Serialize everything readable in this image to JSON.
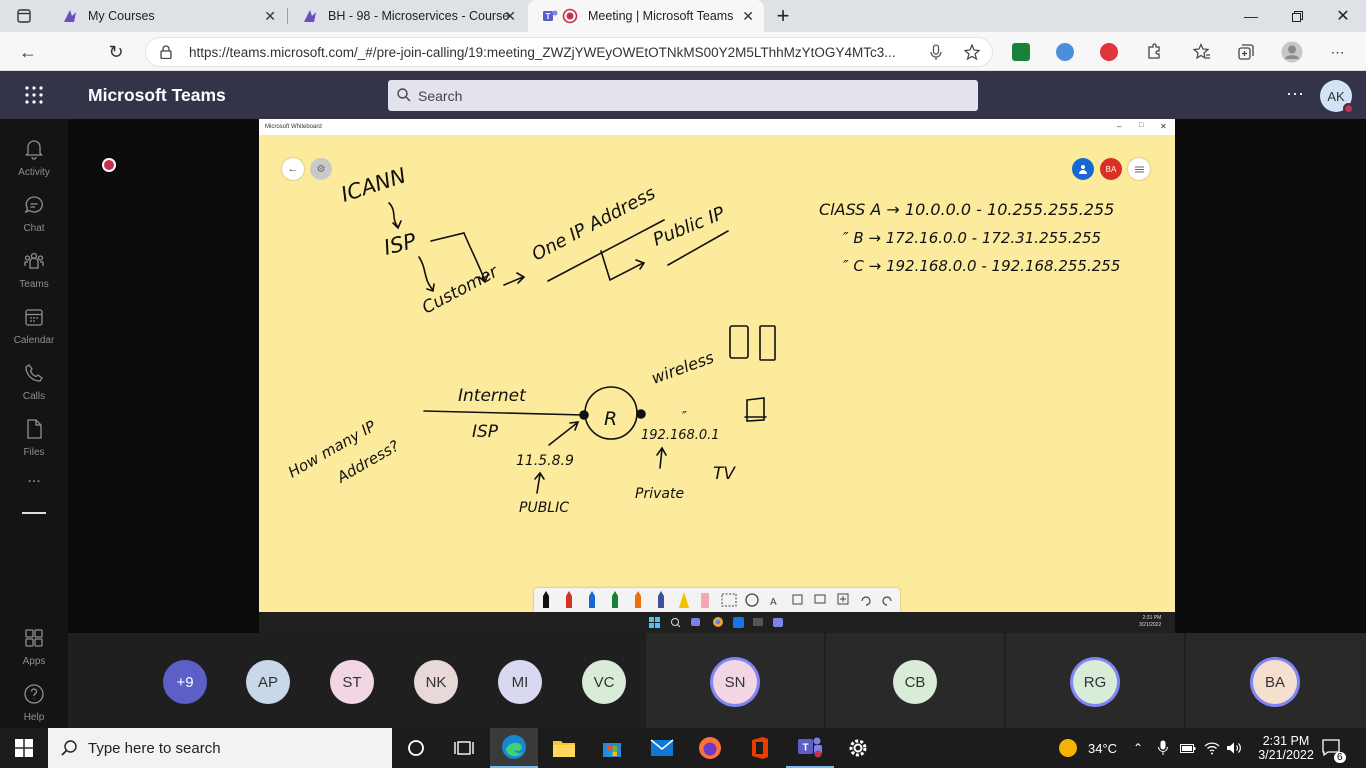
{
  "browser": {
    "tabs": [
      {
        "title": "My Courses"
      },
      {
        "title": "BH - 98 - Microservices - Course"
      },
      {
        "title": "Meeting | Microsoft Teams"
      }
    ],
    "new_tab": "+",
    "url": "https://teams.microsoft.com/_#/pre-join-calling/19:meeting_ZWZjYWEyOWEtOTNkMS00Y2M5LThhMzYtOGY4MTc3..."
  },
  "teams": {
    "app_name": "Microsoft Teams",
    "search_placeholder": "Search",
    "user_initials": "AK",
    "rail": [
      {
        "label": "Activity",
        "icon": "bell-icon"
      },
      {
        "label": "Chat",
        "icon": "chat-icon"
      },
      {
        "label": "Teams",
        "icon": "teams-icon"
      },
      {
        "label": "Calendar",
        "icon": "calendar-icon"
      },
      {
        "label": "Calls",
        "icon": "phone-icon"
      },
      {
        "label": "Files",
        "icon": "file-icon"
      },
      {
        "label": "Apps",
        "icon": "apps-icon"
      },
      {
        "label": "Help",
        "icon": "help-icon"
      }
    ],
    "more": "...",
    "header_more": "···"
  },
  "whiteboard": {
    "window_title": "Microsoft Whiteboard",
    "participants": [
      "BA"
    ],
    "taskbar_time": "2:31 PM",
    "taskbar_date": "3/21/2022",
    "ink_text": {
      "icann": "ICANN",
      "isp": "ISP",
      "customer": "Customer",
      "one_ip": "One IP Address",
      "public_ip": "Public IP",
      "class_a": "ClASS A → 10.0.0.0 - 10.255.255.255",
      "class_b": "″ B → 172.16.0.0 - 172.31.255.255",
      "class_c": "″ C → 192.168.0.0 - 192.168.255.255",
      "wireless": "wireless",
      "internet": "Internet",
      "isp2": "ISP",
      "router": "R",
      "how_many_1": "How many IP",
      "how_many_2": "Address?",
      "public_addr": "11.5.8.9",
      "public": "PUBLIC",
      "private_addr": "192.168.0.1",
      "private": "Private",
      "tv": "TV",
      "ditto": "″"
    }
  },
  "participants": [
    {
      "initials": "+9",
      "color": "#5b5fc7"
    },
    {
      "initials": "AP",
      "color": "#c8d8e8"
    },
    {
      "initials": "ST",
      "color": "#f3d6e4"
    },
    {
      "initials": "NK",
      "color": "#e8d8d8"
    },
    {
      "initials": "MI",
      "color": "#d8d8f0"
    },
    {
      "initials": "VC",
      "color": "#d8ecd8"
    },
    {
      "initials": "SN",
      "color": "#f3d6e4"
    },
    {
      "initials": "CB",
      "color": "#d8ecd8"
    },
    {
      "initials": "RG",
      "color": "#d8ecd8"
    },
    {
      "initials": "BA",
      "color": "#f6dfcf"
    }
  ],
  "windows": {
    "search_placeholder": "Type here to search",
    "weather": "34°C",
    "time": "2:31 PM",
    "date": "3/21/2022",
    "notifications": "6"
  }
}
